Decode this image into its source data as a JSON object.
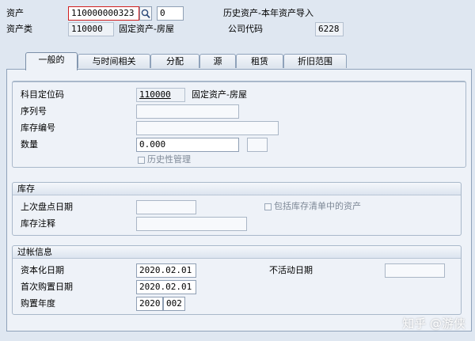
{
  "header": {
    "asset_label": "资产",
    "asset_value": "110000000323",
    "subnumber_value": "0",
    "description": "历史资产-本年资产导入",
    "asset_class_label": "资产类",
    "asset_class_value": "110000",
    "asset_class_desc": "固定资产-房屋",
    "company_code_label": "公司代码",
    "company_code_value": "6228"
  },
  "tabs": [
    {
      "label": "一般的"
    },
    {
      "label": "与时间相关"
    },
    {
      "label": "分配"
    },
    {
      "label": "源"
    },
    {
      "label": "租赁"
    },
    {
      "label": "折旧范围"
    }
  ],
  "general": {
    "account_det_label": "科目定位码",
    "account_det_value": "110000",
    "account_det_desc": "固定资产-房屋",
    "serial_label": "序列号",
    "serial_value": "",
    "inventory_no_label": "库存编号",
    "inventory_no_value": "",
    "quantity_label": "数量",
    "quantity_value": "0.000",
    "unit_value": "",
    "history_mgmt_label": "历史性管理"
  },
  "inventory": {
    "title": "库存",
    "last_count_label": "上次盘点日期",
    "last_count_value": "",
    "include_list_label": "包括库存清单中的资产",
    "note_label": "库存注释",
    "note_value": ""
  },
  "posting": {
    "title": "过帐信息",
    "cap_date_label": "资本化日期",
    "cap_date_value": "2020.02.01",
    "deactivation_label": "不活动日期",
    "deactivation_value": "",
    "first_acq_label": "首次购置日期",
    "first_acq_value": "2020.02.01",
    "acq_year_label": "购置年度",
    "acq_year_value": "2020",
    "acq_period_value": "002"
  },
  "watermark": "知乎 @游侠",
  "colors": {
    "background": "#dfe7f1",
    "panel": "#eef2f8",
    "focus_border": "#d01e1e"
  }
}
